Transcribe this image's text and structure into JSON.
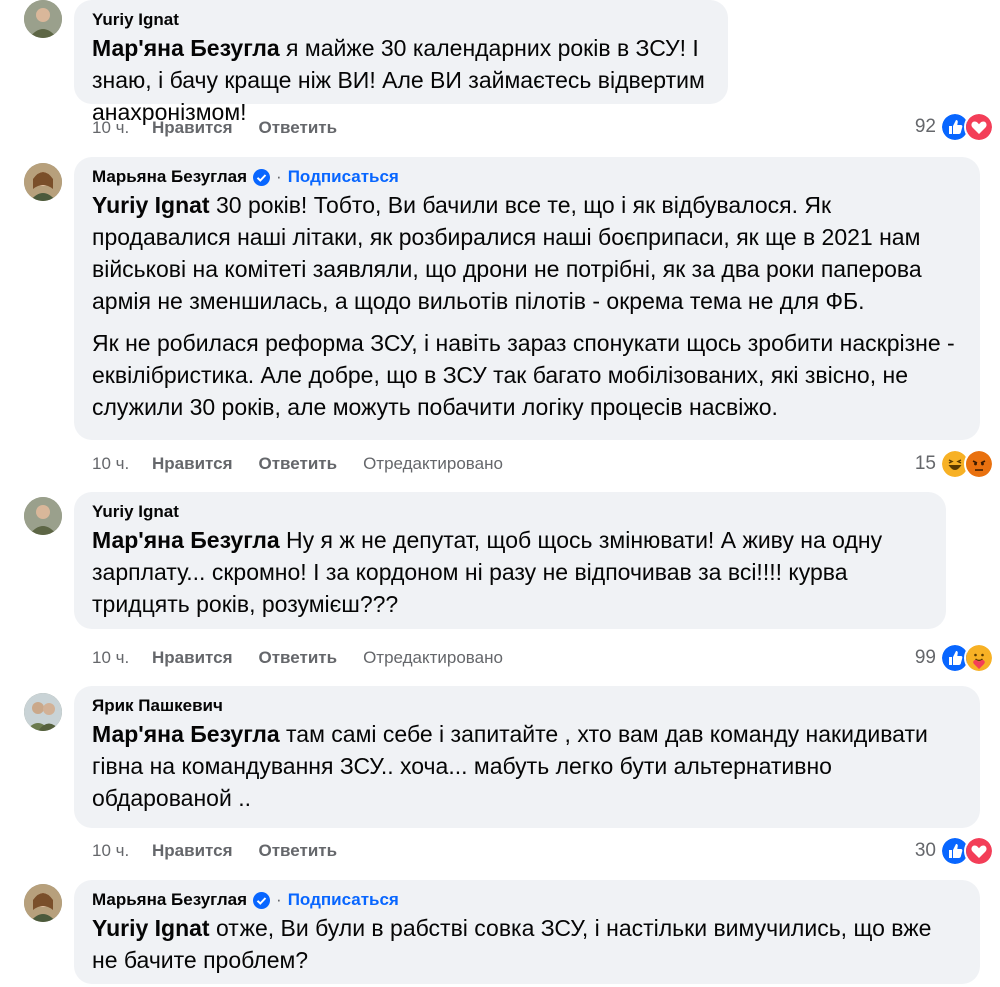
{
  "comments": [
    {
      "author": "Yuriy Ignat",
      "mention": "Мар'яна Безугла",
      "paragraphs": [
        "я майже 30 календарних років в ЗСУ! І знаю, і бачу краще ніж ВИ! Але ВИ займаєтесь відвертим анахронізмом!"
      ],
      "time": "10 ч.",
      "like": "Нравится",
      "reply": "Ответить",
      "edited": "",
      "reaction_count": "92",
      "reactions": [
        "like-icon",
        "love-icon"
      ]
    },
    {
      "author": "Марьяна Безуглая",
      "verified": true,
      "subscribe": "Подписаться",
      "separator": "·",
      "mention": "Yuriy Ignat",
      "paragraphs": [
        "30 років! Тобто, Ви бачили все те, що і як відбувалося. Як продавалися наші літаки, як розбиралися наші боєприпаси, як ще в 2021 нам військові на комітеті заявляли, що дрони не потрібні, як за два роки паперова армія не зменшилась, а щодо вильотів пілотів - окрема тема не для ФБ.",
        "Як не робилася реформа ЗСУ, і навіть зараз спонукати щось зробити наскрізне - еквілібристика. Але добре, що в ЗСУ так багато мобілізованих, які звісно, не служили 30 років, але можуть побачити логіку процесів насвіжо."
      ],
      "time": "10 ч.",
      "like": "Нравится",
      "reply": "Ответить",
      "edited": "Отредактировано",
      "reaction_count": "15",
      "reactions": [
        "haha-icon",
        "angry-icon"
      ]
    },
    {
      "author": "Yuriy Ignat",
      "mention": "Мар'яна Безугла",
      "paragraphs": [
        "Ну я ж не депутат, щоб щось змінювати! А живу на одну зарплату... скромно! І за кордоном ні разу не відпочивав за всі!!!! курва тридцять років, розумієш???"
      ],
      "time": "10 ч.",
      "like": "Нравится",
      "reply": "Ответить",
      "edited": "Отредактировано",
      "reaction_count": "99",
      "reactions": [
        "like-icon",
        "care-icon"
      ]
    },
    {
      "author": "Ярик Пашкевич",
      "mention": "Мар'яна Безугла",
      "paragraphs": [
        "там самі себе і запитайте , хто вам дав команду накидивати гівна на командування ЗСУ.. хоча... мабуть легко бути альтернативно обдарованой .."
      ],
      "time": "10 ч.",
      "like": "Нравится",
      "reply": "Ответить",
      "edited": "",
      "reaction_count": "30",
      "reactions": [
        "like-icon",
        "love-icon"
      ]
    },
    {
      "author": "Марьяна Безуглая",
      "verified": true,
      "subscribe": "Подписаться",
      "separator": "·",
      "mention": "Yuriy Ignat",
      "paragraphs": [
        "отже, Ви були в рабстві совка ЗСУ, і настільки вимучились, що вже не бачите проблем?"
      ]
    }
  ],
  "colors": {
    "bubble": "#f0f2f5",
    "link": "#0866ff",
    "muted": "#65676b",
    "like": "#0866ff",
    "love": "#f33e58",
    "haha": "#f7b125",
    "angry": "#e9710f"
  }
}
